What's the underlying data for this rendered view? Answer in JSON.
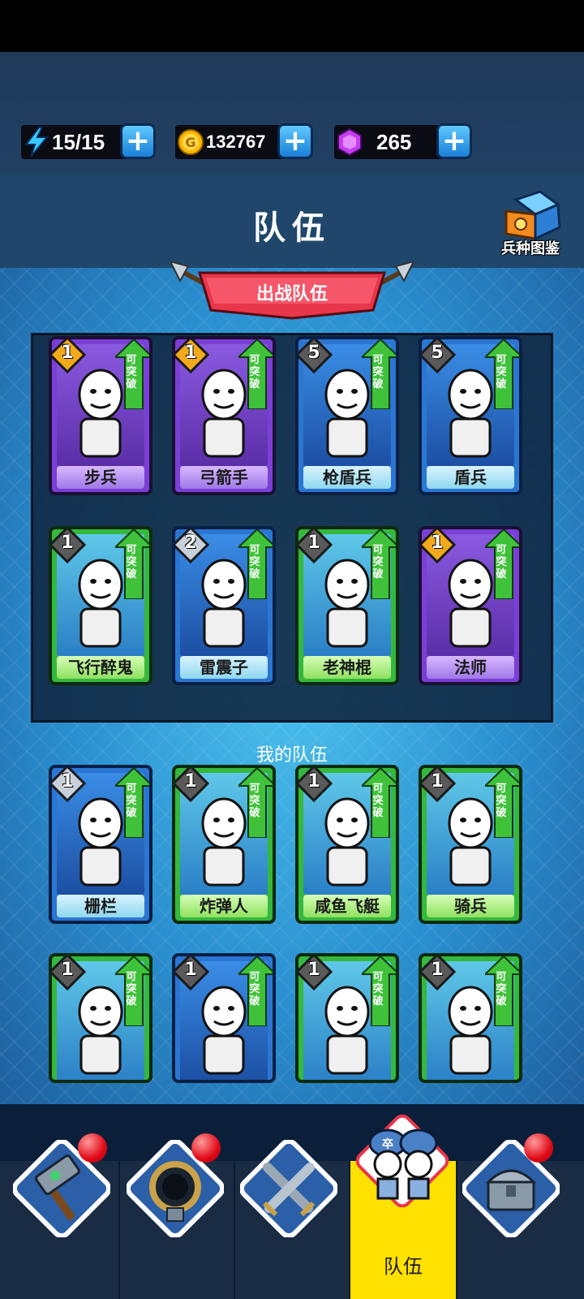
{
  "resources": {
    "energy": {
      "value": "15/15",
      "icon": "lightning-icon"
    },
    "coins": {
      "value": "132767",
      "icon": "gold-coin-icon"
    },
    "gems": {
      "value": "265",
      "icon": "purple-gem-icon"
    }
  },
  "header": {
    "title": "队伍",
    "codex_label": "兵种图鉴"
  },
  "battle_team": {
    "title": "出战队伍",
    "cards": [
      {
        "name": "步兵",
        "level": "1",
        "tag": "可突破",
        "rarity": "purple"
      },
      {
        "name": "弓箭手",
        "level": "1",
        "tag": "可突破",
        "rarity": "purple"
      },
      {
        "name": "枪盾兵",
        "level": "5",
        "tag": "可突破",
        "rarity": "blue"
      },
      {
        "name": "盾兵",
        "level": "5",
        "tag": "可突破",
        "rarity": "blue"
      },
      {
        "name": "飞行醉鬼",
        "level": "1",
        "tag": "可突破",
        "rarity": "green"
      },
      {
        "name": "雷震子",
        "level": "2",
        "tag": "可突破",
        "rarity": "blue"
      },
      {
        "name": "老神棍",
        "level": "1",
        "tag": "可突破",
        "rarity": "green"
      },
      {
        "name": "法师",
        "level": "1",
        "tag": "可突破",
        "rarity": "purple"
      }
    ]
  },
  "my_team": {
    "title": "我的队伍",
    "cards": [
      {
        "name": "栅栏",
        "level": "1",
        "tag": "可突破",
        "rarity": "blue"
      },
      {
        "name": "炸弹人",
        "level": "1",
        "tag": "可突破",
        "rarity": "green"
      },
      {
        "name": "咸鱼飞艇",
        "level": "1",
        "tag": "可突破",
        "rarity": "green"
      },
      {
        "name": "骑兵",
        "level": "1",
        "tag": "可突破",
        "rarity": "green"
      },
      {
        "name": "",
        "level": "1",
        "tag": "可突破",
        "rarity": "green"
      },
      {
        "name": "",
        "level": "1",
        "tag": "可突破",
        "rarity": "blue"
      },
      {
        "name": "",
        "level": "1",
        "tag": "可突破",
        "rarity": "green"
      },
      {
        "name": "",
        "level": "1",
        "tag": "可突破",
        "rarity": "green"
      }
    ]
  },
  "bottom_nav": {
    "items": [
      {
        "icon": "hammer-icon",
        "badge": true
      },
      {
        "icon": "ring-portal-icon",
        "badge": true
      },
      {
        "icon": "crossed-swords-icon",
        "badge": false
      },
      {
        "icon": "soldiers-icon",
        "badge": false,
        "label": "队伍",
        "active": true
      },
      {
        "icon": "treasure-chest-icon",
        "badge": true
      }
    ]
  }
}
